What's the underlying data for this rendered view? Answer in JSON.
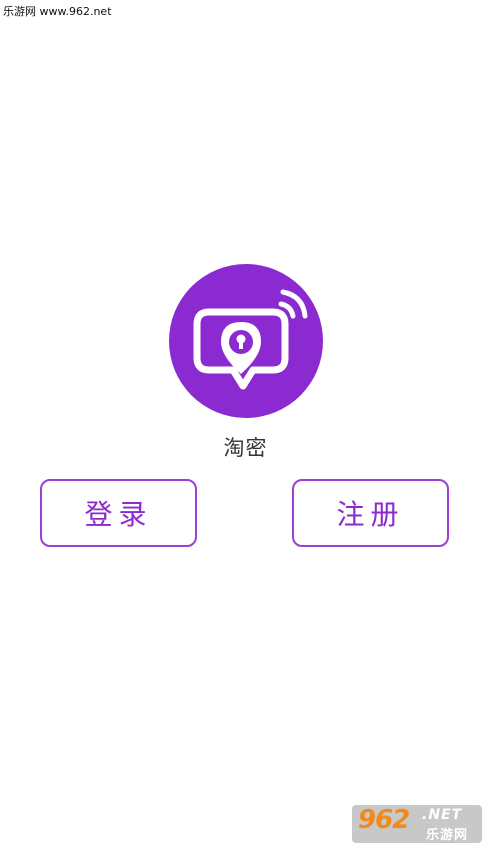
{
  "watermark": {
    "top_text": "乐游网 www.962.net",
    "bottom_number": "962",
    "bottom_net": ".NET",
    "bottom_cn": "乐游网"
  },
  "app": {
    "name": "淘密",
    "logo_icon": "location-lock-chat-icon",
    "accent_color": "#8b2ad0"
  },
  "buttons": {
    "login_label": "登录",
    "register_label": "注册"
  }
}
